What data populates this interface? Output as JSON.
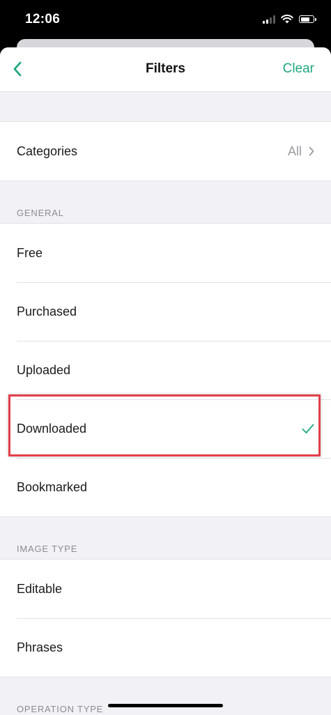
{
  "status_bar": {
    "time": "12:06"
  },
  "nav": {
    "title": "Filters",
    "clear_label": "Clear"
  },
  "categories": {
    "label": "Categories",
    "value": "All"
  },
  "general": {
    "header": "GENERAL",
    "items": [
      {
        "label": "Free",
        "selected": false
      },
      {
        "label": "Purchased",
        "selected": false
      },
      {
        "label": "Uploaded",
        "selected": false
      },
      {
        "label": "Downloaded",
        "selected": true
      },
      {
        "label": "Bookmarked",
        "selected": false
      }
    ]
  },
  "image_type": {
    "header": "IMAGE TYPE",
    "items": [
      {
        "label": "Editable"
      },
      {
        "label": "Phrases"
      }
    ]
  },
  "operation_type": {
    "header": "OPERATION TYPE"
  },
  "colors": {
    "accent": "#1fa77e",
    "highlight": "#e2404a"
  }
}
